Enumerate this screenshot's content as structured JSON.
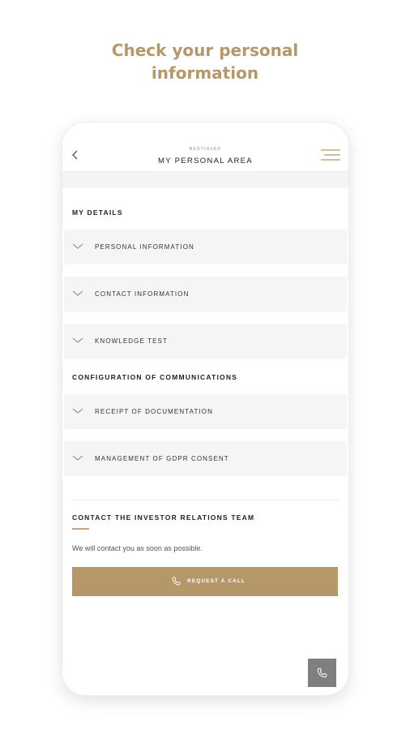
{
  "headline": {
    "line1": "Check your personal",
    "line2": "information"
  },
  "topbar": {
    "brand": "BESTINVER",
    "title": "MY PERSONAL AREA"
  },
  "sections": {
    "my_details": {
      "title": "MY DETAILS",
      "items": [
        {
          "label": "PERSONAL INFORMATION"
        },
        {
          "label": "CONTACT INFORMATION"
        },
        {
          "label": "KNOWLEDGE TEST"
        }
      ]
    },
    "communications": {
      "title": "CONFIGURATION OF COMMUNICATIONS",
      "items": [
        {
          "label": "RECEIPT OF DOCUMENTATION"
        },
        {
          "label": "MANAGEMENT OF GDPR CONSENT"
        }
      ]
    },
    "contact": {
      "title": "CONTACT THE INVESTOR RELATIONS TEAM",
      "text": "We will contact you as soon as possible.",
      "button_label": "REQUEST A CALL"
    }
  },
  "colors": {
    "accent": "#b5986a",
    "panel": "#f5f5f5",
    "fab": "#7f7f7f"
  },
  "icons": {
    "back": "chevron-left-icon",
    "menu": "hamburger-menu-icon",
    "expand": "chevron-down-icon",
    "call": "phone-icon"
  }
}
